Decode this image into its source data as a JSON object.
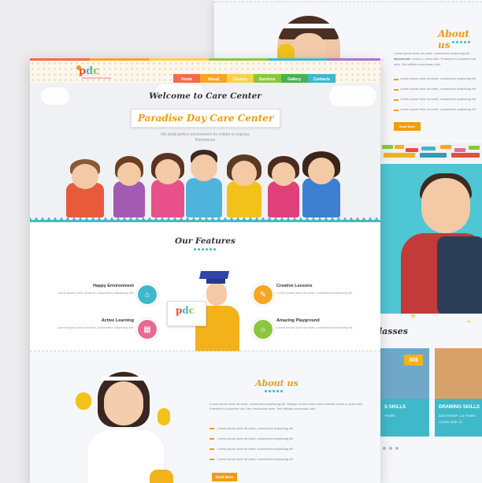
{
  "back_page": {
    "about_title": "About us",
    "about_lines": [
      "Lorem ipsum dolor sit amet, consectetur adipiscing elit. Aliquam ut",
      "sed molestie luctus a, porta odio. Praesent eu pharetra nisi",
      "ante. Sed efficitur accumsan odio."
    ],
    "about_items": [
      "Lorem ipsum dolor sit amet, consectetur adipiscing elit",
      "Lorem ipsum dolor sit amet, consectetur adipiscing elit",
      "Lorem ipsum dolor sit amet, consectetur adipiscing elit",
      "Lorem ipsum dolor sit amet, consectetur adipiscing elit"
    ],
    "read_more": "Read More",
    "classes_title": "lasses",
    "class_cards": [
      {
        "name": "S SKILLS",
        "age": "YEARS",
        "class_size": "",
        "color": "#3fb9c9",
        "photo": "#6fa8c9"
      },
      {
        "name": "DRAWING SKILLS",
        "age": "AGE GROUP: 2-4 YEARS",
        "class_size": "CLASS SIZE: 12",
        "color": "#3fb9c9",
        "photo": "#d7a16a",
        "price": "30$"
      }
    ],
    "price_first": "30$"
  },
  "front_page": {
    "logo": {
      "letters": [
        "p",
        "d",
        "c"
      ],
      "letter_colors": [
        "#e74c3c",
        "#3fb9c9",
        "#8cc63f"
      ],
      "tagline": "PARADISE DAY CARE CENTER"
    },
    "nav": [
      {
        "label": "Home",
        "color": "#f36b4c"
      },
      {
        "label": "About",
        "color": "#f5a623"
      },
      {
        "label": "Classes",
        "color": "#f8d04a"
      },
      {
        "label": "Services",
        "color": "#8cc63f"
      },
      {
        "label": "Gallery",
        "color": "#4caf50"
      },
      {
        "label": "Contacts",
        "color": "#3fb9c9"
      }
    ],
    "hero": {
      "title": "Welcome to Care Center",
      "headline": "Paradise Day Care Center",
      "subtitle": "We build perfect environment for childer to express themselves"
    },
    "features": {
      "title": "Our Features",
      "items": [
        {
          "title": "Happy Environment",
          "desc": "Lorem ipsum dolor sit amet, consectetur adipiscing elit.",
          "icon": "school-icon",
          "color": "#3fb9c9"
        },
        {
          "title": "Active Learning",
          "desc": "Lorem ipsum dolor sit amet, consectetur adipiscing elit.",
          "icon": "abc-blocks-icon",
          "color": "#e86a92"
        },
        {
          "title": "Creative Lessons",
          "desc": "Lorem ipsum dolor sit amet, consectetur adipiscing elit.",
          "icon": "palette-icon",
          "color": "#f5a623"
        },
        {
          "title": "Amazing Playground",
          "desc": "Lorem ipsum dolor sit amet, consectetur adipiscing elit.",
          "icon": "playground-icon",
          "color": "#8cc63f"
        }
      ]
    },
    "about": {
      "title": "About us",
      "paragraph": "Lorem ipsum dolor sit amet, consectetur adipiscing elit. Aliquam ut sed lorem sed molestie luctus a, porta odio. Praesent eu pharetra nisi. Nec vestibulum ante. Sed efficitur accumsan odio.",
      "items": [
        "Lorem ipsum dolor sit amet, consectetur adipiscing elit",
        "Lorem ipsum dolor sit amet, consectetur adipiscing elit",
        "Lorem ipsum dolor sit amet, consectetur adipiscing elit",
        "Lorem ipsum dolor sit amet, consectetur adipiscing elit"
      ],
      "read_more": "Read More"
    }
  },
  "colors": {
    "accent_orange": "#f39c12",
    "accent_teal": "#3fb9c9",
    "accent_yellow": "#f3b21a"
  }
}
